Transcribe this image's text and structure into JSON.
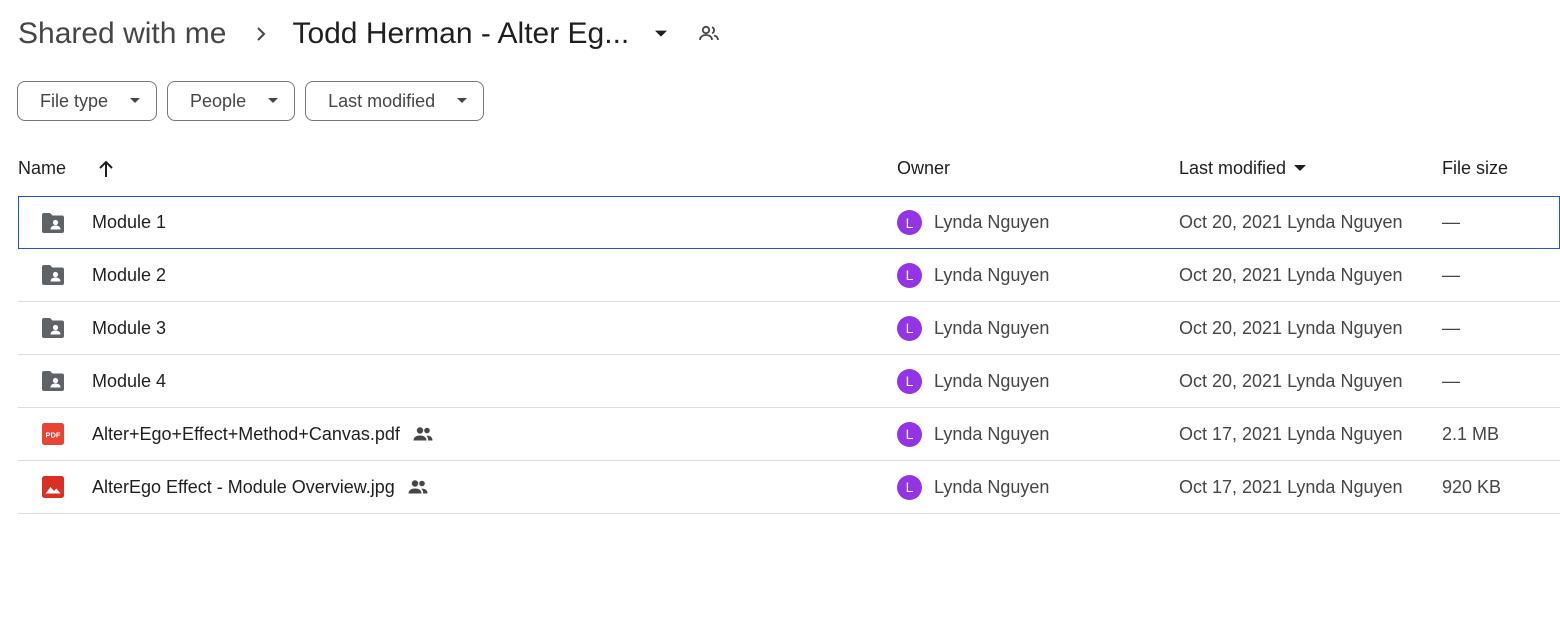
{
  "breadcrumb": {
    "root": "Shared with me",
    "current": "Todd Herman - Alter Eg..."
  },
  "filters": [
    {
      "label": "File type"
    },
    {
      "label": "People"
    },
    {
      "label": "Last modified"
    }
  ],
  "columns": {
    "name": "Name",
    "owner": "Owner",
    "last_modified": "Last modified",
    "file_size": "File size"
  },
  "sort": {
    "column": "Name",
    "direction": "ascending"
  },
  "colors": {
    "avatar": "#9334e6",
    "selection": "#1a56d6",
    "pdf": "#ea4335",
    "image": "#d93025",
    "folder": "#5f6368"
  },
  "rows": [
    {
      "name": "Module 1",
      "icon": "shared-folder-icon",
      "shared": false,
      "owner": "Lynda Nguyen",
      "owner_initial": "L",
      "modified": "Oct 20, 2021 Lynda Nguyen",
      "size": "—",
      "selected": true
    },
    {
      "name": "Module 2",
      "icon": "shared-folder-icon",
      "shared": false,
      "owner": "Lynda Nguyen",
      "owner_initial": "L",
      "modified": "Oct 20, 2021 Lynda Nguyen",
      "size": "—",
      "selected": false
    },
    {
      "name": "Module 3",
      "icon": "shared-folder-icon",
      "shared": false,
      "owner": "Lynda Nguyen",
      "owner_initial": "L",
      "modified": "Oct 20, 2021 Lynda Nguyen",
      "size": "—",
      "selected": false
    },
    {
      "name": "Module 4",
      "icon": "shared-folder-icon",
      "shared": false,
      "owner": "Lynda Nguyen",
      "owner_initial": "L",
      "modified": "Oct 20, 2021 Lynda Nguyen",
      "size": "—",
      "selected": false
    },
    {
      "name": "Alter+Ego+Effect+Method+Canvas.pdf",
      "icon": "pdf-icon",
      "icon_text": "PDF",
      "shared": true,
      "owner": "Lynda Nguyen",
      "owner_initial": "L",
      "modified": "Oct 17, 2021 Lynda Nguyen",
      "size": "2.1 MB",
      "selected": false
    },
    {
      "name": "AlterEgo Effect - Module Overview.jpg",
      "icon": "image-icon",
      "shared": true,
      "owner": "Lynda Nguyen",
      "owner_initial": "L",
      "modified": "Oct 17, 2021 Lynda Nguyen",
      "size": "920 KB",
      "selected": false
    }
  ]
}
